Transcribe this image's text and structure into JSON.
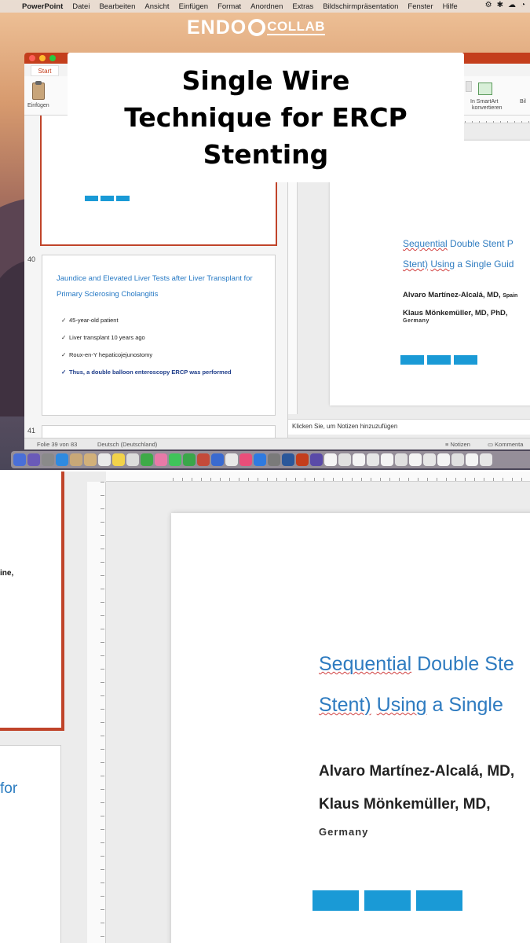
{
  "menubar": {
    "apple": "",
    "app": "PowerPoint",
    "items": [
      "Datei",
      "Bearbeiten",
      "Ansicht",
      "Einfügen",
      "Format",
      "Anordnen",
      "Extras",
      "Bildschirmpräsentation",
      "Fenster",
      "Hilfe"
    ]
  },
  "brand": {
    "endo": "ENDO",
    "collab": "COLLAB"
  },
  "overlay_title": "Single Wire\nTechnique for ERCP\nStenting",
  "ribbon": {
    "tab_start": "Start",
    "paste": "Einfügen",
    "smartart_line1": "In SmartArt",
    "smartart_line2": "konvertieren",
    "right_partial": "Bil"
  },
  "thumbnails": {
    "slide40_number": "40",
    "slide41_number": "41",
    "slide40_title": "Jaundice and Elevated Liver Tests after Liver Transplant for Primary Sclerosing Cholangitis",
    "slide40_bullets": [
      "45-year-old patient",
      "Liver transplant 10 years ago",
      "Roux-en-Y hepaticojejunostomy",
      "Thus, a double balloon enteroscopy ERCP was performed"
    ]
  },
  "slide": {
    "title_line1_u": "Sequential",
    "title_line1_rest": " Double Stent P",
    "title_line2_u1": "Stent)",
    "title_line2_mid": " ",
    "title_line2_u2": "Using",
    "title_line2_rest": " a Single Guid",
    "author1_name": "Alvaro Martínez-Alcalá, MD,",
    "author1_country": "Spain",
    "author2": "Klaus Mönkemüller, MD, PhD,",
    "country": "Germany"
  },
  "notes_placeholder": "Klicken Sie, um Notizen hinzuzufügen",
  "status": {
    "slide_counter": "Folie 39 von 83",
    "language": "Deutsch (Deutschland)",
    "notes_button": "Notizen",
    "comments_button": "Kommenta"
  },
  "zoom": {
    "left_frag1": "ine,",
    "left_frag2": "for",
    "title_line1_u": "Sequential",
    "title_line1_rest": " Double Ste",
    "title_line2_u1": "Stent)",
    "title_line2_u2": "Using",
    "title_line2_rest": " a Single",
    "author1": "Alvaro Martínez-Alcalá, MD,",
    "author2": "Klaus Mönkemüller, MD,",
    "country": "Germany"
  },
  "colors": {
    "accent_red": "#c0442a",
    "slide_blue": "#2f7cc0",
    "button_blue": "#1a9ad6"
  }
}
